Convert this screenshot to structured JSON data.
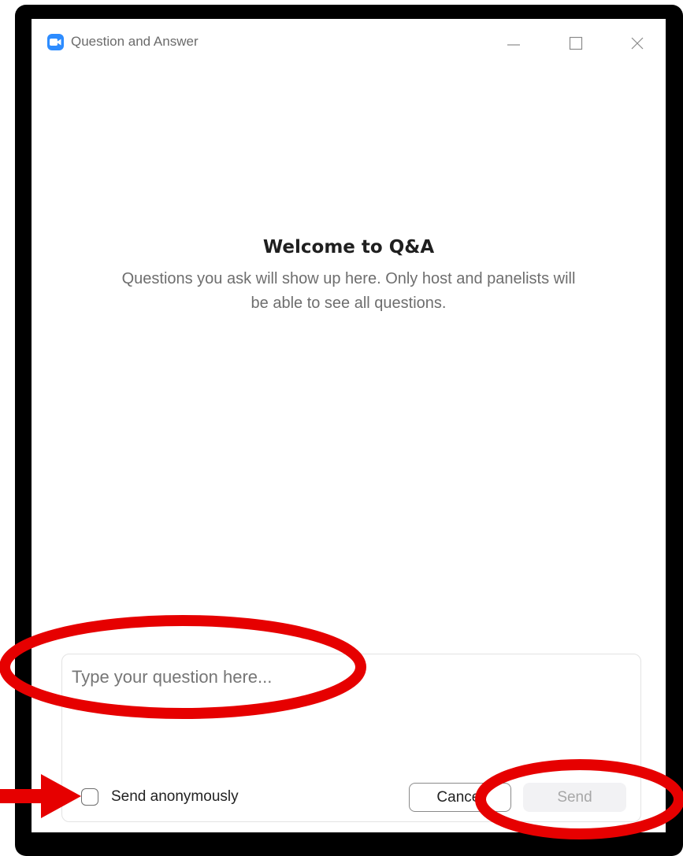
{
  "window": {
    "title": "Question and Answer",
    "app_icon": "zoom-video-icon",
    "controls": [
      "minimize-icon",
      "maximize-icon",
      "close-icon"
    ]
  },
  "welcome": {
    "title": "Welcome to Q&A",
    "description": "Questions you ask will show up here. Only host and panelists will be able to see all questions."
  },
  "composer": {
    "placeholder": "Type your question here...",
    "value": "",
    "anonymous_label": "Send anonymously",
    "anonymous_checked": false,
    "cancel_label": "Cancel",
    "send_label": "Send",
    "send_enabled": false
  },
  "colors": {
    "accent": "#2d8cff",
    "annotation": "#e60000",
    "frame": "#000000"
  }
}
